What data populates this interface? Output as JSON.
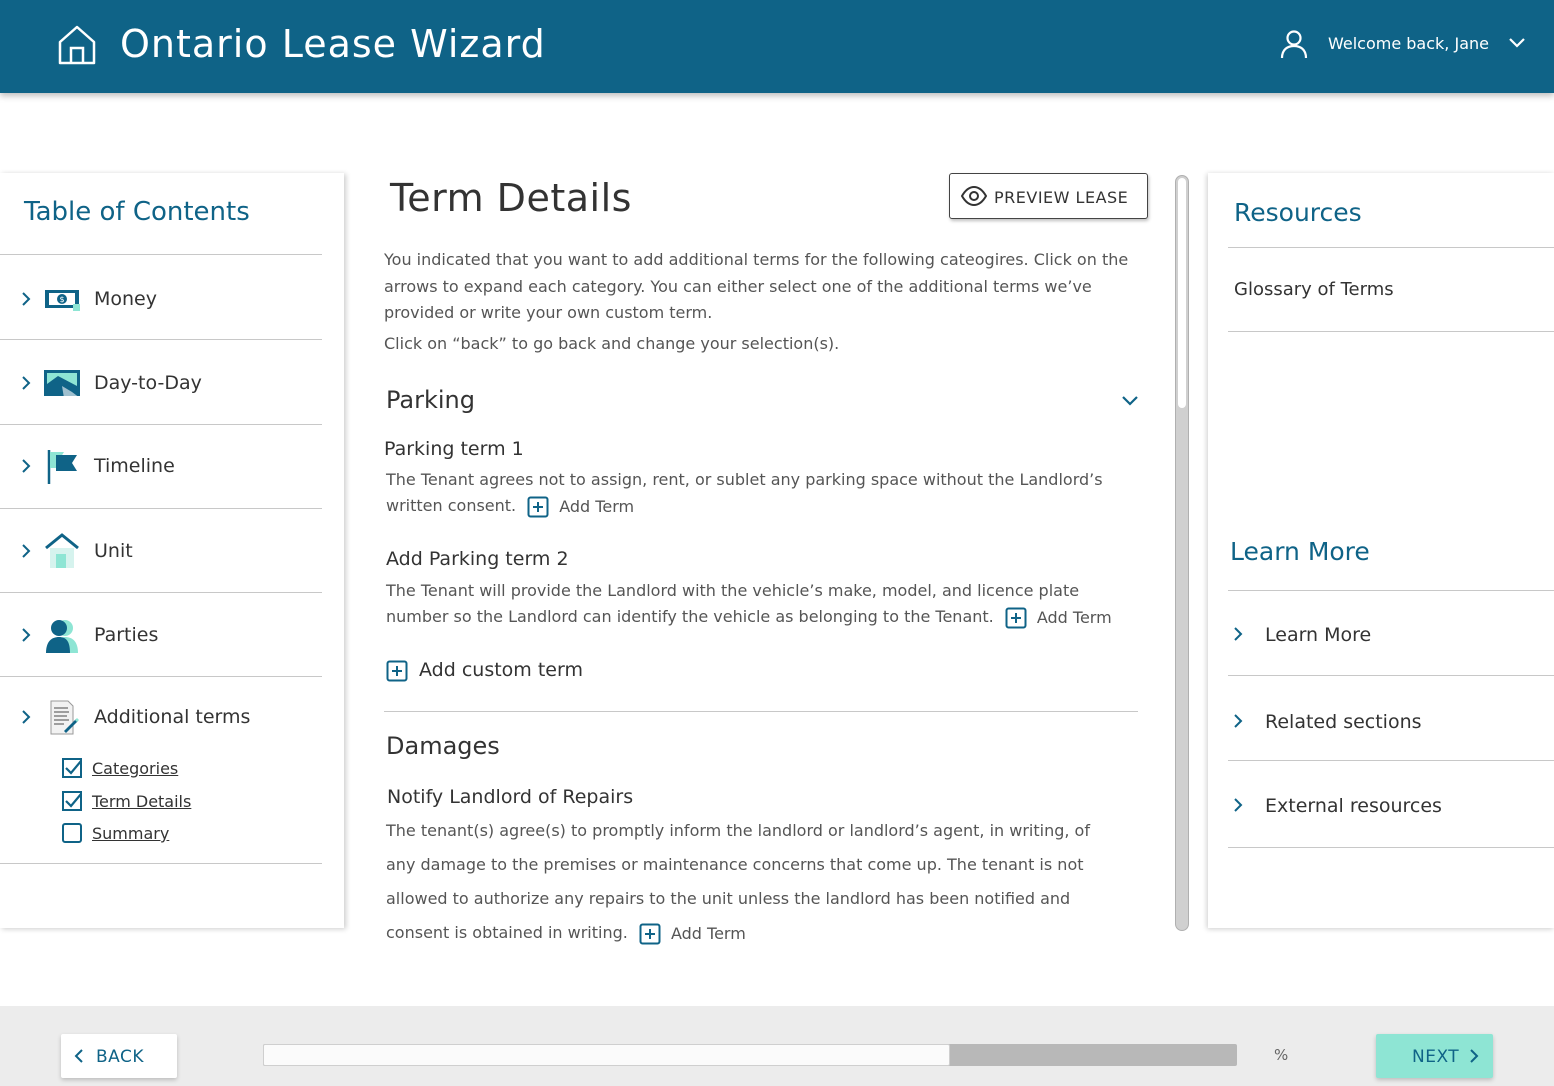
{
  "header": {
    "app_title": "Ontario Lease Wizard",
    "welcome": "Welcome back, Jane",
    "home_icon": "home-icon",
    "user_icon": "user-icon",
    "brand_color": "#0f6387"
  },
  "toc": {
    "title": "Table of Contents",
    "items": [
      {
        "label": "Money",
        "icon": "money-icon"
      },
      {
        "label": "Day-to-Day",
        "icon": "day-to-day-icon"
      },
      {
        "label": "Timeline",
        "icon": "flag-icon"
      },
      {
        "label": "Unit",
        "icon": "house-icon"
      },
      {
        "label": "Parties",
        "icon": "parties-icon"
      },
      {
        "label": "Additional terms",
        "icon": "document-icon"
      }
    ],
    "subitems": [
      {
        "label": "Categories",
        "checked": true
      },
      {
        "label": "Term Details",
        "checked": true
      },
      {
        "label": "Summary",
        "checked": false
      }
    ]
  },
  "main": {
    "title": "Term Details",
    "preview_label": "PREVIEW LEASE",
    "intro": "You indicated that you want to add additional terms for the following cateogires. Click on the arrows to expand each category. You can either select one of the additional terms we’ve provided or write your own custom term.",
    "intro2": "Click on “back” to go back and change your selection(s).",
    "add_term_label": "Add Term",
    "sections": [
      {
        "title": "Parking",
        "terms": [
          {
            "title": "Parking term 1",
            "body": "The Tenant agrees not to assign, rent, or sublet any parking space without the Landlord’s written consent."
          },
          {
            "title": "Add Parking term 2",
            "body": "The Tenant will provide the Landlord with the vehicle’s make, model, and licence plate number so the Landlord can identify the vehicle as belonging to the Tenant."
          }
        ],
        "custom_label": "Add custom term"
      },
      {
        "title": "Damages",
        "terms": [
          {
            "title": "Notify Landlord of Repairs",
            "body": "The tenant(s) agree(s) to promptly inform the landlord or landlord’s agent, in writing, of any damage to the premises or maintenance concerns that come up. The tenant is not allowed to authorize any repairs to the unit unless the landlord has been notified and consent is obtained in writing."
          }
        ]
      }
    ]
  },
  "resources": {
    "title": "Resources",
    "links": [
      "Glossary of Terms"
    ],
    "learn_more_title": "Learn More",
    "learn_more_items": [
      "Learn More",
      "Related sections",
      "External resources"
    ]
  },
  "footer": {
    "back_label": "BACK",
    "next_label": "NEXT",
    "percent_label": "%",
    "progress_fraction": 0.705,
    "accent_color": "#8ee5d4"
  }
}
